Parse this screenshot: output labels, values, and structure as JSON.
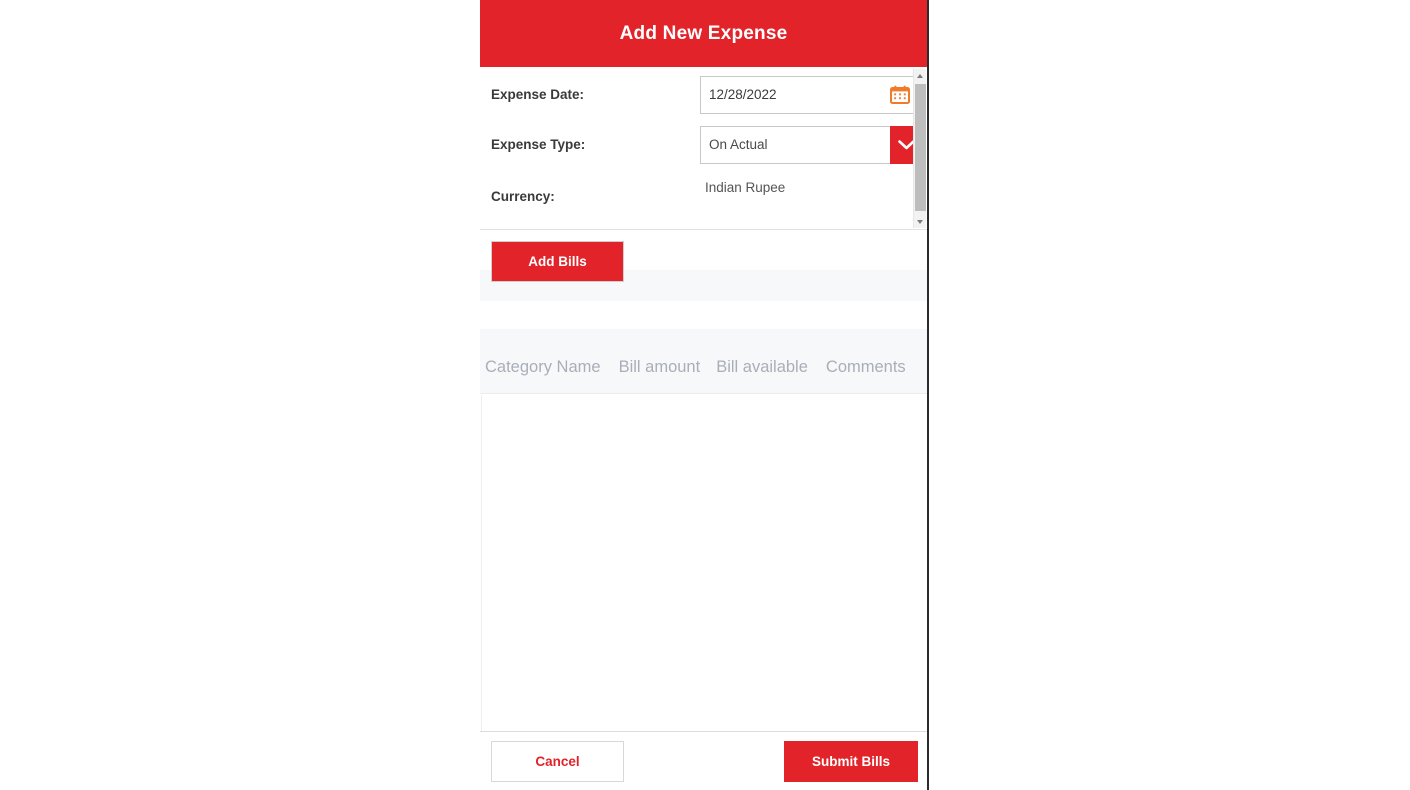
{
  "theme": {
    "primary_red": "#E2232A",
    "calendar_icon_color": "#F07B2B",
    "header_text_color": "#FFFFFF",
    "table_header_text_color": "#A9AEB8",
    "band_gray": "#F7F8FA"
  },
  "header": {
    "title": "Add New Expense"
  },
  "form": {
    "fields": [
      {
        "label": "Expense Date:",
        "value": "12/28/2022",
        "icon": "calendar-icon",
        "type": "date"
      },
      {
        "label": "Expense Type:",
        "value": "On Actual",
        "icon": "chevron-down-icon",
        "type": "select"
      },
      {
        "label": "Currency:",
        "value": "Indian Rupee",
        "type": "text"
      }
    ],
    "scrollbar": {
      "up_icon": "scroll-up-arrow-icon",
      "down_icon": "scroll-down-arrow-icon"
    }
  },
  "actions": {
    "add_bills_label": "Add Bills"
  },
  "table": {
    "columns": [
      "Category Name",
      "Bill amount",
      "Bill available",
      "Comments"
    ],
    "rows": []
  },
  "footer": {
    "cancel_label": "Cancel",
    "submit_label": "Submit Bills"
  }
}
